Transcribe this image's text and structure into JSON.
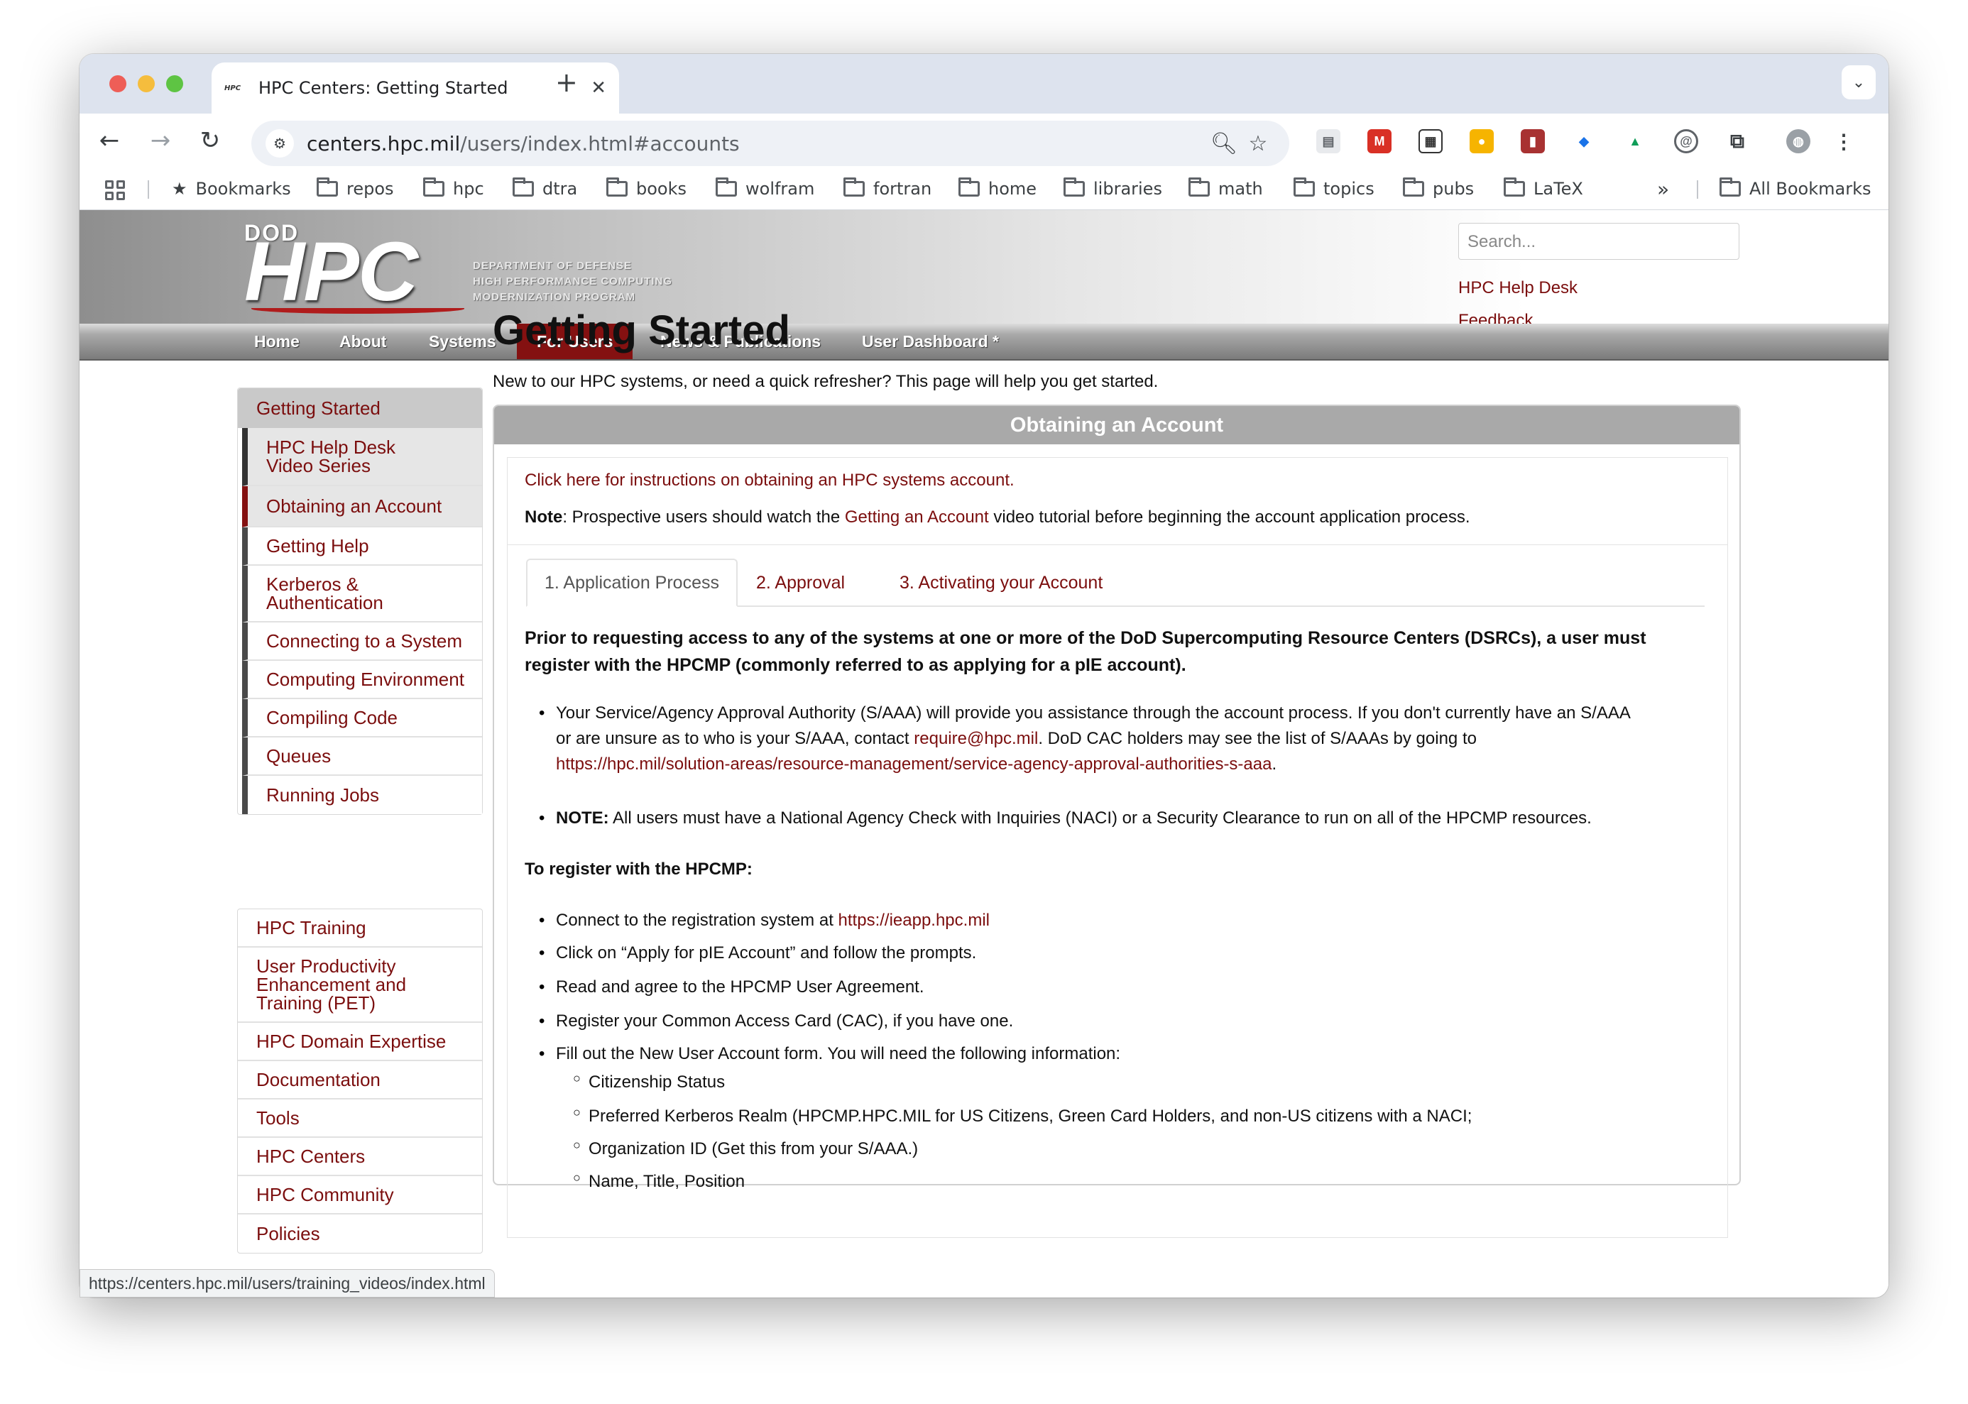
{
  "browser": {
    "tab_title": "HPC Centers: Getting Started",
    "tab_favicon": "HPC",
    "url_host": "centers.hpc.mil",
    "url_path": "/users/index.html#accounts",
    "status_url": "https://centers.hpc.mil/users/training_videos/index.html",
    "bookmarks": [
      "Bookmarks",
      "repos",
      "hpc",
      "dtra",
      "books",
      "wolfram",
      "fortran",
      "home",
      "libraries",
      "math",
      "topics",
      "pubs",
      "LaTeX"
    ],
    "all_bookmarks": "All Bookmarks"
  },
  "header": {
    "logo_dod": "DOD",
    "logo_hpc": "HPC",
    "logo_line1": "DEPARTMENT OF DEFENSE",
    "logo_line2": "HIGH PERFORMANCE COMPUTING",
    "logo_line3": "MODERNIZATION PROGRAM",
    "search_placeholder": "Search...",
    "help_desk": "HPC Help Desk",
    "feedback": "Feedback"
  },
  "nav": [
    "Home",
    "About",
    "Systems",
    "For Users",
    "News & Publications",
    "User Dashboard *"
  ],
  "sidebar": {
    "head": "Getting Started",
    "sub_items": [
      "HPC Help Desk Video Series",
      "Obtaining an Account",
      "Getting Help",
      "Kerberos & Authentication",
      "Connecting to a System",
      "Computing Environment",
      "Compiling Code",
      "Queues",
      "Running Jobs"
    ],
    "items": [
      "HPC Training",
      "User Productivity Enhancement and Training (PET)",
      "HPC Domain Expertise",
      "Documentation",
      "Tools",
      "HPC Centers",
      "HPC Community",
      "Policies"
    ]
  },
  "content": {
    "title": "Getting Started",
    "lead": "New to our HPC systems, or need a quick refresher? This page will help you get started.",
    "panel_title": "Obtaining an Account",
    "instructions_link": "Click here for instructions on obtaining an HPC systems account.",
    "note_label": "Note",
    "note_pre": ": Prospective users should watch the ",
    "note_link": "Getting an Account",
    "note_post": " video tutorial before beginning the account application process.",
    "tabs": [
      "1. Application Process",
      "2. Approval",
      "3. Activating your Account"
    ],
    "intro_line1": "Prior to requesting access to any of the systems at one or more of the DoD Supercomputing Resource Centers (DSRCs), a user must",
    "intro_line2": "register with the HPCMP (commonly referred to as applying for a pIE account).",
    "saaa_line1": "Your Service/Agency Approval Authority (S/AAA) will provide you assistance through the account process. If you don't currently have an S/AAA",
    "saaa_line2_pre": "or are unsure as to who is your S/AAA, contact ",
    "saaa_email": "require@hpc.mil",
    "saaa_line2_post": ". DoD CAC holders may see the list of S/AAAs by going to",
    "saaa_url": "https://hpc.mil/solution-areas/resource-management/service-agency-approval-authorities-s-aaa",
    "saaa_url_post": ".",
    "naci_label": "NOTE:",
    "naci_text": " All users must have a National Agency Check with Inquiries (NACI) or a Security Clearance to run on all of the HPCMP resources.",
    "register_heading": "To register with the HPCMP:",
    "step1_pre": "Connect to the registration system at ",
    "step1_link": "https://ieapp.hpc.mil",
    "step2": "Click on “Apply for pIE Account” and follow the prompts.",
    "step3": "Read and agree to the HPCMP User Agreement.",
    "step4": "Register your Common Access Card (CAC), if you have one.",
    "step5": "Fill out the New User Account form. You will need the following information:",
    "sub_steps": [
      "Citizenship Status",
      "Preferred Kerberos Realm (HPCMP.HPC.MIL for US Citizens, Green Card Holders, and non-US citizens with a NACI;",
      "Organization ID (Get this from your S/AAA.)",
      "Name, Title, Position"
    ]
  }
}
